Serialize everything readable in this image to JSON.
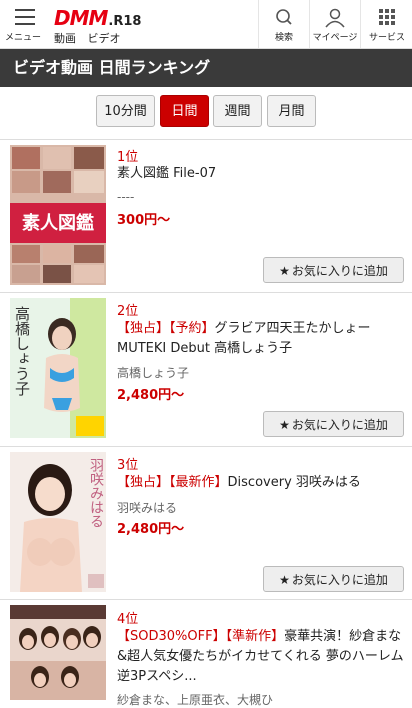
{
  "header": {
    "menu_label": "メニュー",
    "logo_main": "DMM",
    "logo_suffix": ".R18",
    "sub_links": [
      "動画",
      "ビデオ"
    ],
    "buttons": [
      {
        "label": "検索",
        "icon": "search-icon"
      },
      {
        "label": "マイページ",
        "icon": "user-icon"
      },
      {
        "label": "サービス",
        "icon": "grid-icon"
      }
    ]
  },
  "page_title": "ビデオ動画 日間ランキング",
  "tabs": [
    {
      "label": "10分間",
      "active": false
    },
    {
      "label": "日間",
      "active": true
    },
    {
      "label": "週間",
      "active": false
    },
    {
      "label": "月間",
      "active": false
    }
  ],
  "items": [
    {
      "rank": "1位",
      "tags": [],
      "title": "素人図鑑 File-07",
      "actor": "----",
      "price": "300円〜",
      "thumb_text": "素人図鑑",
      "fav_label": "お気に入りに追加"
    },
    {
      "rank": "2位",
      "tags": [
        "【独占】",
        "【予約】"
      ],
      "title": "グラビア四天王たかしょーMUTEKI Debut 高橋しょう子",
      "actor": "高橋しょう子",
      "price": "2,480円〜",
      "thumb_text": "高橋しょう子",
      "fav_label": "お気に入りに追加"
    },
    {
      "rank": "3位",
      "tags": [
        "【独占】",
        "【最新作】"
      ],
      "title": "Discovery 羽咲みはる",
      "actor": "羽咲みはる",
      "price": "2,480円〜",
      "thumb_text": "羽咲みはる",
      "fav_label": "お気に入りに追加"
    },
    {
      "rank": "4位",
      "tags": [
        "【SOD30%OFF】",
        "【準新作】"
      ],
      "title": "豪華共演！紗倉まな&超人気女優たちがイカせてくれる 夢のハーレム逆3Pスペシ...",
      "actor": "紗倉まな、上原亜衣、大槻ひ",
      "price": "",
      "thumb_text": "",
      "fav_label": ""
    }
  ],
  "colors": {
    "accent": "#cc0000",
    "title_bar": "#3a3a3a"
  }
}
